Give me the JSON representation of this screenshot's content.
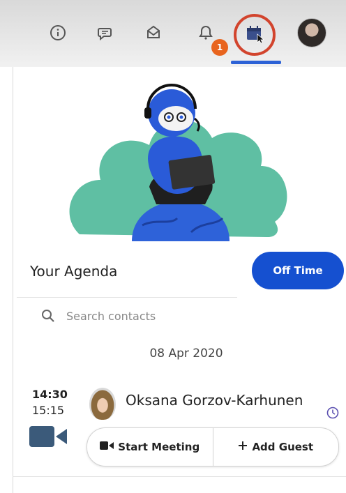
{
  "topbar": {
    "icons": [
      "info-icon",
      "chat-icon",
      "inbox-icon",
      "notifications-icon",
      "calendar-icon",
      "profile-avatar"
    ],
    "notification_badge": "1",
    "active_item": "calendar",
    "accent_color": "#2d62d6",
    "highlight_color": "#d2442d"
  },
  "agenda": {
    "title": "Your Agenda",
    "off_time_label": "Off Time",
    "search_placeholder": "Search contacts",
    "date": "08 Apr 2020"
  },
  "meeting": {
    "start_time": "14:30",
    "end_time": "15:15",
    "contact_name": "Oksana Gorzov-Karhunen",
    "start_meeting_label": "Start Meeting",
    "add_guest_label": "Add Guest"
  },
  "colors": {
    "primary_button": "#1550d0",
    "illustration_bg": "#5fbfa3",
    "character_blue": "#2a5bd8",
    "globe_blue": "#2e62d9"
  }
}
